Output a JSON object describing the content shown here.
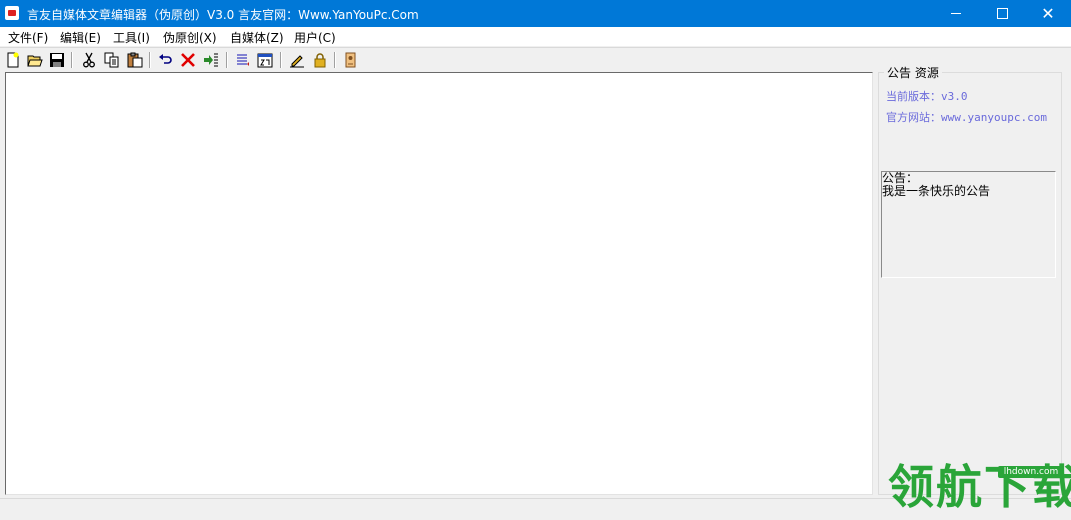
{
  "window": {
    "title": "言友自媒体文章编辑器（伪原创）V3.0 言友官网：Www.YanYouPc.Com",
    "minimize": "minimize-icon",
    "maximize": "maximize-icon",
    "close_glyph": "✕"
  },
  "menu": {
    "items": [
      {
        "label": "文件(F)"
      },
      {
        "label": "编辑(E)"
      },
      {
        "label": "工具(I)"
      },
      {
        "label": "伪原创(X)"
      },
      {
        "label": "自媒体(Z)"
      },
      {
        "label": "用户(C)"
      }
    ]
  },
  "toolbar": {
    "icons": [
      "new-file-icon",
      "open-folder-icon",
      "save-icon",
      "cut-icon",
      "copy-icon",
      "paste-icon",
      "undo-icon",
      "delete-icon",
      "insert-icon",
      "list-icon",
      "calendar-icon",
      "edit-icon",
      "lock-icon",
      "user-card-icon"
    ]
  },
  "panel": {
    "group_title": "公告 资源",
    "version_line": "当前版本：v3.0",
    "website_line": "官方网站：www.yanyoupc.com",
    "notice_label": "公告：",
    "notice_text": "我是一条快乐的公告"
  },
  "watermark": {
    "text": "领航下载",
    "url": "lhdown.com"
  },
  "colors": {
    "titlebar": "#0078d7",
    "info_text": "#6a6adb",
    "watermark": "#2aa539"
  }
}
